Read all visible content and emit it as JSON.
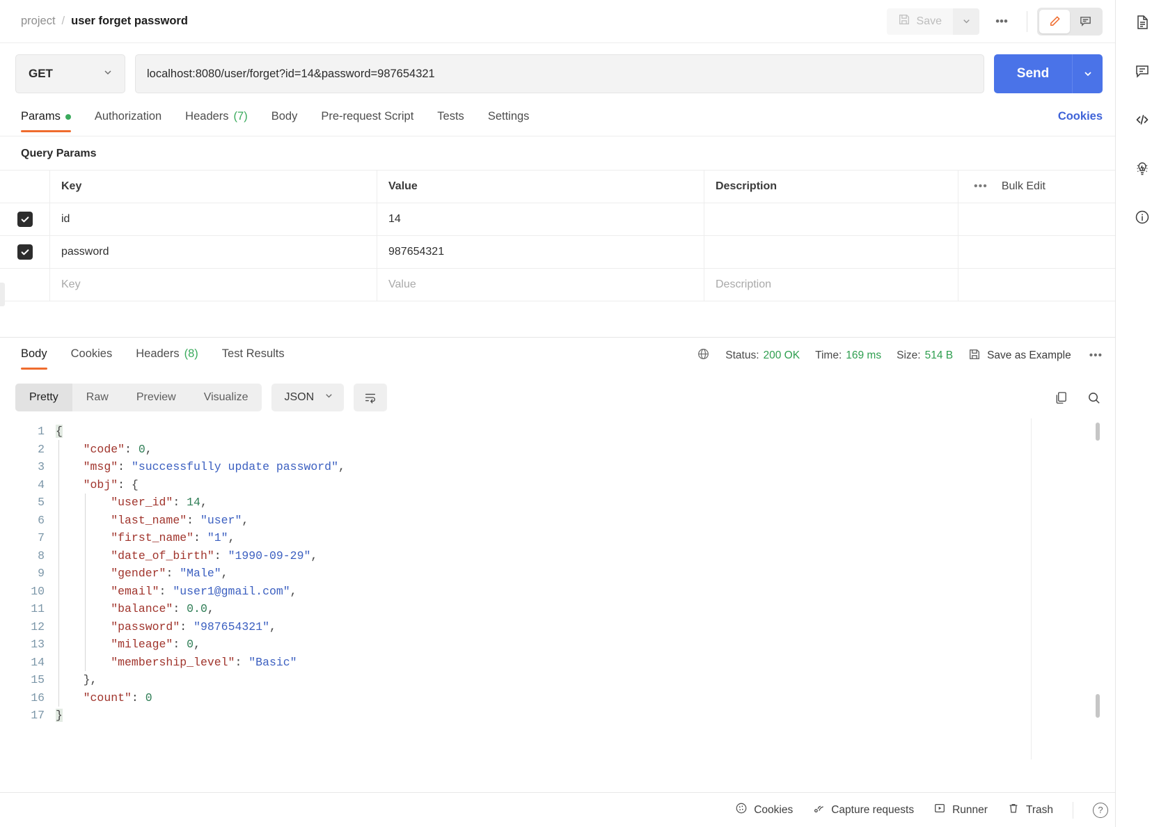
{
  "header": {
    "breadcrumb_root": "project",
    "breadcrumb_sep": "/",
    "breadcrumb_leaf": "user forget password",
    "save_label": "Save",
    "more_dots": "•••"
  },
  "request": {
    "method": "GET",
    "url": "localhost:8080/user/forget?id=14&password=987654321",
    "send_label": "Send"
  },
  "request_tabs": [
    {
      "label": "Params",
      "badge": "",
      "dot": true,
      "active": true
    },
    {
      "label": "Authorization",
      "badge": "",
      "dot": false,
      "active": false
    },
    {
      "label": "Headers",
      "badge": "(7)",
      "dot": false,
      "active": false
    },
    {
      "label": "Body",
      "badge": "",
      "dot": false,
      "active": false
    },
    {
      "label": "Pre-request Script",
      "badge": "",
      "dot": false,
      "active": false
    },
    {
      "label": "Tests",
      "badge": "",
      "dot": false,
      "active": false
    },
    {
      "label": "Settings",
      "badge": "",
      "dot": false,
      "active": false
    }
  ],
  "cookies_link": "Cookies",
  "query_params": {
    "section_title": "Query Params",
    "columns": {
      "key": "Key",
      "value": "Value",
      "description": "Description"
    },
    "bulk_edit_label": "Bulk Edit",
    "bulk_dots": "•••",
    "rows": [
      {
        "checked": true,
        "key": "id",
        "value": "14",
        "description": ""
      },
      {
        "checked": true,
        "key": "password",
        "value": "987654321",
        "description": ""
      }
    ],
    "placeholder_row": {
      "key": "Key",
      "value": "Value",
      "description": "Description"
    }
  },
  "response_tabs": [
    {
      "label": "Body",
      "badge": "",
      "active": true
    },
    {
      "label": "Cookies",
      "badge": "",
      "active": false
    },
    {
      "label": "Headers",
      "badge": "(8)",
      "active": false
    },
    {
      "label": "Test Results",
      "badge": "",
      "active": false
    }
  ],
  "response_meta": {
    "status_label": "Status:",
    "status_value": "200 OK",
    "time_label": "Time:",
    "time_value": "169 ms",
    "size_label": "Size:",
    "size_value": "514 B",
    "save_example_label": "Save as Example",
    "more_dots": "•••"
  },
  "view_toolbar": {
    "modes": [
      {
        "label": "Pretty",
        "active": true
      },
      {
        "label": "Raw",
        "active": false
      },
      {
        "label": "Preview",
        "active": false
      },
      {
        "label": "Visualize",
        "active": false
      }
    ],
    "format": "JSON"
  },
  "response_body": {
    "language": "json",
    "line_numbers": [
      1,
      2,
      3,
      4,
      5,
      6,
      7,
      8,
      9,
      10,
      11,
      12,
      13,
      14,
      15,
      16,
      17
    ],
    "json": {
      "code": 0,
      "msg": "successfully update password",
      "obj": {
        "user_id": 14,
        "last_name": "user",
        "first_name": "1",
        "date_of_birth": "1990-09-29",
        "gender": "Male",
        "email": "user1@gmail.com",
        "balance": 0.0,
        "password": "987654321",
        "mileage": 0,
        "membership_level": "Basic"
      },
      "count": 0
    },
    "lines": [
      {
        "n": 1,
        "indent": 0,
        "tokens": [
          {
            "t": "p",
            "v": "{"
          }
        ]
      },
      {
        "n": 2,
        "indent": 1,
        "tokens": [
          {
            "t": "k",
            "v": "\"code\""
          },
          {
            "t": "p",
            "v": ": "
          },
          {
            "t": "n",
            "v": "0"
          },
          {
            "t": "p",
            "v": ","
          }
        ]
      },
      {
        "n": 3,
        "indent": 1,
        "tokens": [
          {
            "t": "k",
            "v": "\"msg\""
          },
          {
            "t": "p",
            "v": ": "
          },
          {
            "t": "s",
            "v": "\"successfully update password\""
          },
          {
            "t": "p",
            "v": ","
          }
        ]
      },
      {
        "n": 4,
        "indent": 1,
        "tokens": [
          {
            "t": "k",
            "v": "\"obj\""
          },
          {
            "t": "p",
            "v": ": {"
          }
        ]
      },
      {
        "n": 5,
        "indent": 2,
        "tokens": [
          {
            "t": "k",
            "v": "\"user_id\""
          },
          {
            "t": "p",
            "v": ": "
          },
          {
            "t": "n",
            "v": "14"
          },
          {
            "t": "p",
            "v": ","
          }
        ]
      },
      {
        "n": 6,
        "indent": 2,
        "tokens": [
          {
            "t": "k",
            "v": "\"last_name\""
          },
          {
            "t": "p",
            "v": ": "
          },
          {
            "t": "s",
            "v": "\"user\""
          },
          {
            "t": "p",
            "v": ","
          }
        ]
      },
      {
        "n": 7,
        "indent": 2,
        "tokens": [
          {
            "t": "k",
            "v": "\"first_name\""
          },
          {
            "t": "p",
            "v": ": "
          },
          {
            "t": "s",
            "v": "\"1\""
          },
          {
            "t": "p",
            "v": ","
          }
        ]
      },
      {
        "n": 8,
        "indent": 2,
        "tokens": [
          {
            "t": "k",
            "v": "\"date_of_birth\""
          },
          {
            "t": "p",
            "v": ": "
          },
          {
            "t": "s",
            "v": "\"1990-09-29\""
          },
          {
            "t": "p",
            "v": ","
          }
        ]
      },
      {
        "n": 9,
        "indent": 2,
        "tokens": [
          {
            "t": "k",
            "v": "\"gender\""
          },
          {
            "t": "p",
            "v": ": "
          },
          {
            "t": "s",
            "v": "\"Male\""
          },
          {
            "t": "p",
            "v": ","
          }
        ]
      },
      {
        "n": 10,
        "indent": 2,
        "tokens": [
          {
            "t": "k",
            "v": "\"email\""
          },
          {
            "t": "p",
            "v": ": "
          },
          {
            "t": "s",
            "v": "\"user1@gmail.com\""
          },
          {
            "t": "p",
            "v": ","
          }
        ]
      },
      {
        "n": 11,
        "indent": 2,
        "tokens": [
          {
            "t": "k",
            "v": "\"balance\""
          },
          {
            "t": "p",
            "v": ": "
          },
          {
            "t": "n",
            "v": "0.0"
          },
          {
            "t": "p",
            "v": ","
          }
        ]
      },
      {
        "n": 12,
        "indent": 2,
        "tokens": [
          {
            "t": "k",
            "v": "\"password\""
          },
          {
            "t": "p",
            "v": ": "
          },
          {
            "t": "s",
            "v": "\"987654321\""
          },
          {
            "t": "p",
            "v": ","
          }
        ]
      },
      {
        "n": 13,
        "indent": 2,
        "tokens": [
          {
            "t": "k",
            "v": "\"mileage\""
          },
          {
            "t": "p",
            "v": ": "
          },
          {
            "t": "n",
            "v": "0"
          },
          {
            "t": "p",
            "v": ","
          }
        ]
      },
      {
        "n": 14,
        "indent": 2,
        "tokens": [
          {
            "t": "k",
            "v": "\"membership_level\""
          },
          {
            "t": "p",
            "v": ": "
          },
          {
            "t": "s",
            "v": "\"Basic\""
          }
        ]
      },
      {
        "n": 15,
        "indent": 1,
        "tokens": [
          {
            "t": "p",
            "v": "},"
          }
        ]
      },
      {
        "n": 16,
        "indent": 1,
        "tokens": [
          {
            "t": "k",
            "v": "\"count\""
          },
          {
            "t": "p",
            "v": ": "
          },
          {
            "t": "n",
            "v": "0"
          }
        ]
      },
      {
        "n": 17,
        "indent": 0,
        "tokens": [
          {
            "t": "p",
            "v": "}"
          }
        ]
      }
    ]
  },
  "footer": {
    "items": [
      {
        "label": "Cookies",
        "icon": "cookie-icon"
      },
      {
        "label": "Capture requests",
        "icon": "satellite-icon"
      },
      {
        "label": "Runner",
        "icon": "play-box-icon"
      },
      {
        "label": "Trash",
        "icon": "trash-icon"
      }
    ],
    "help": "?"
  },
  "right_rail": [
    {
      "icon": "documentation-icon"
    },
    {
      "icon": "comment-icon"
    },
    {
      "icon": "code-icon"
    },
    {
      "icon": "mock-lightbulb-icon"
    },
    {
      "icon": "info-icon"
    }
  ],
  "colors": {
    "accent_orange": "#ef6c2e",
    "send_blue": "#4a73e8",
    "link_blue": "#3f63d8",
    "status_green": "#2e9e4f",
    "json_key": "#a0342c",
    "json_string": "#3b5fc0",
    "json_number": "#2e7d55"
  }
}
